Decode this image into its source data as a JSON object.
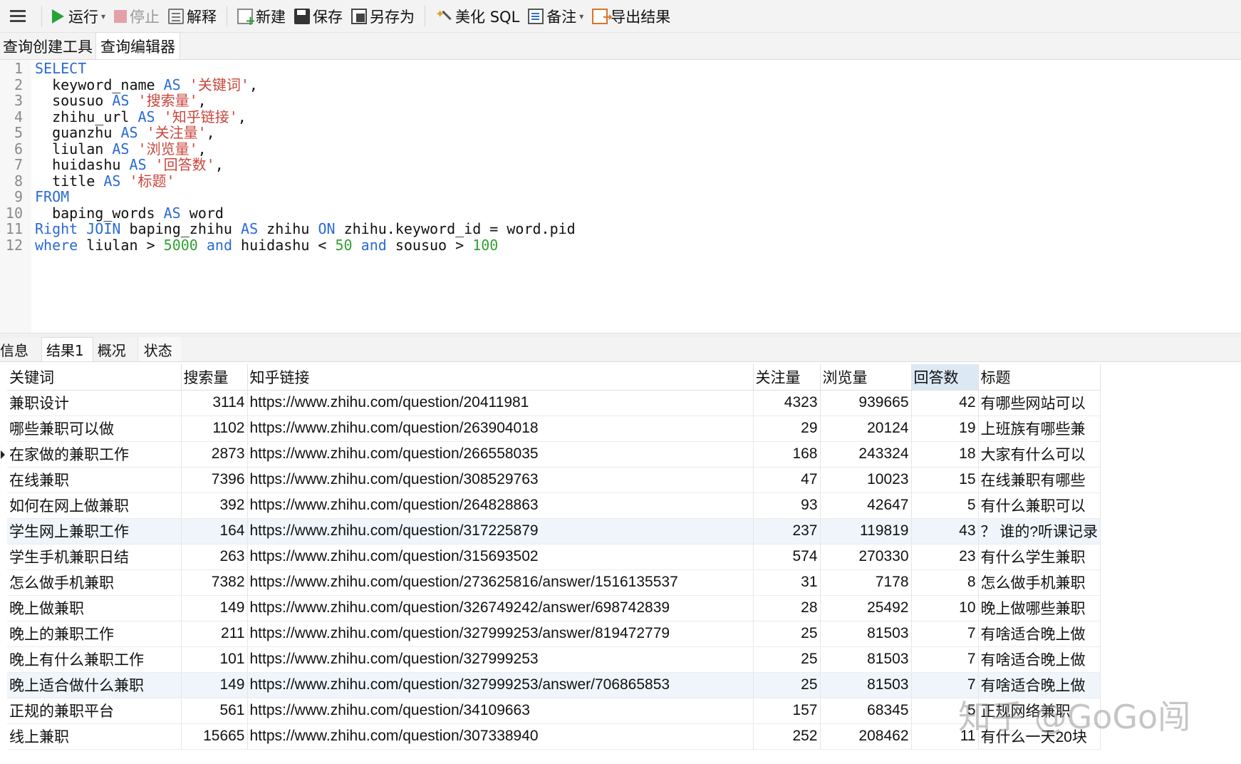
{
  "toolbar": {
    "run": "运行",
    "stop": "停止",
    "explain": "解释",
    "new": "新建",
    "save": "保存",
    "save_as": "另存为",
    "beautify": "美化 SQL",
    "comment": "备注",
    "export": "导出结果"
  },
  "query_tabs": [
    "查询创建工具",
    "查询编辑器"
  ],
  "editor": {
    "line_numbers": [
      "1",
      "2",
      "3",
      "4",
      "5",
      "6",
      "7",
      "8",
      "9",
      "10",
      "11",
      "12"
    ]
  },
  "result_tabs": [
    "信息",
    "结果1",
    "概况",
    "状态"
  ],
  "grid": {
    "columns": [
      "关键词",
      "搜索量",
      "知乎链接",
      "关注量",
      "浏览量",
      "回答数",
      "标题"
    ],
    "rows": [
      [
        "兼职设计",
        "3114",
        "https://www.zhihu.com/question/20411981",
        "4323",
        "939665",
        "42",
        "有哪些网站可以"
      ],
      [
        "哪些兼职可以做",
        "1102",
        "https://www.zhihu.com/question/263904018",
        "29",
        "20124",
        "19",
        "上班族有哪些兼"
      ],
      [
        "在家做的兼职工作",
        "2873",
        "https://www.zhihu.com/question/266558035",
        "168",
        "243324",
        "18",
        "大家有什么可以"
      ],
      [
        "在线兼职",
        "7396",
        "https://www.zhihu.com/question/308529763",
        "47",
        "10023",
        "15",
        "在线兼职有哪些"
      ],
      [
        "如何在网上做兼职",
        "392",
        "https://www.zhihu.com/question/264828863",
        "93",
        "42647",
        "5",
        "有什么兼职可以"
      ],
      [
        "学生网上兼职工作",
        "164",
        "https://www.zhihu.com/question/317225879",
        "237",
        "119819",
        "43",
        "？ 谁的?听课记录"
      ],
      [
        "学生手机兼职日结",
        "263",
        "https://www.zhihu.com/question/315693502",
        "574",
        "270330",
        "23",
        "有什么学生兼职"
      ],
      [
        "怎么做手机兼职",
        "7382",
        "https://www.zhihu.com/question/273625816/answer/1516135537",
        "31",
        "7178",
        "8",
        "怎么做手机兼职"
      ],
      [
        "晚上做兼职",
        "149",
        "https://www.zhihu.com/question/326749242/answer/698742839",
        "28",
        "25492",
        "10",
        "晚上做哪些兼职"
      ],
      [
        "晚上的兼职工作",
        "211",
        "https://www.zhihu.com/question/327999253/answer/819472779",
        "25",
        "81503",
        "7",
        "有啥适合晚上做"
      ],
      [
        "晚上有什么兼职工作",
        "101",
        "https://www.zhihu.com/question/327999253",
        "25",
        "81503",
        "7",
        "有啥适合晚上做"
      ],
      [
        "晚上适合做什么兼职",
        "149",
        "https://www.zhihu.com/question/327999253/answer/706865853",
        "25",
        "81503",
        "7",
        "有啥适合晚上做"
      ],
      [
        "正规的兼职平台",
        "561",
        "https://www.zhihu.com/question/34109663",
        "157",
        "68345",
        "5",
        "正规网络兼职"
      ],
      [
        "线上兼职",
        "15665",
        "https://www.zhihu.com/question/307338940",
        "252",
        "208462",
        "11",
        "有什么一天20块"
      ]
    ]
  },
  "watermark": "知乎 @GoGo闯"
}
